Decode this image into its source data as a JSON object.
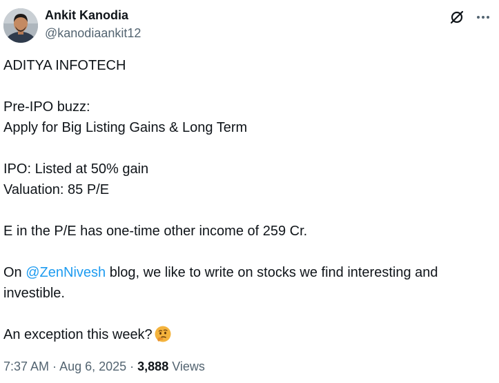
{
  "author": {
    "name": "Ankit Kanodia",
    "handle": "@kanodiaankit12"
  },
  "tweet": {
    "line_1": "ADITYA INFOTECH",
    "line_2": "Pre-IPO buzz:",
    "line_3": "Apply for Big Listing Gains & Long Term",
    "line_4": "IPO: Listed at 50% gain",
    "line_5": "Valuation: 85 P/E",
    "line_6": "E in the P/E has one-time other income of 259 Cr.",
    "line_7_prefix": "On ",
    "line_7_mention": "@ZenNivesh",
    "line_7_suffix": " blog, we like to write on stocks we find interesting and investible.",
    "line_8": "An exception this week?",
    "emoji_icon": "thinking-face-icon"
  },
  "meta": {
    "time": "7:37 AM",
    "separator": " · ",
    "date": "Aug 6, 2025",
    "view_count": "3,888",
    "views_label": "Views"
  },
  "icons": {
    "grok": "grok-icon",
    "more": "more-icon"
  },
  "colors": {
    "text": "#0f1419",
    "secondary": "#536471",
    "link": "#1d9bf0",
    "background": "#ffffff"
  }
}
